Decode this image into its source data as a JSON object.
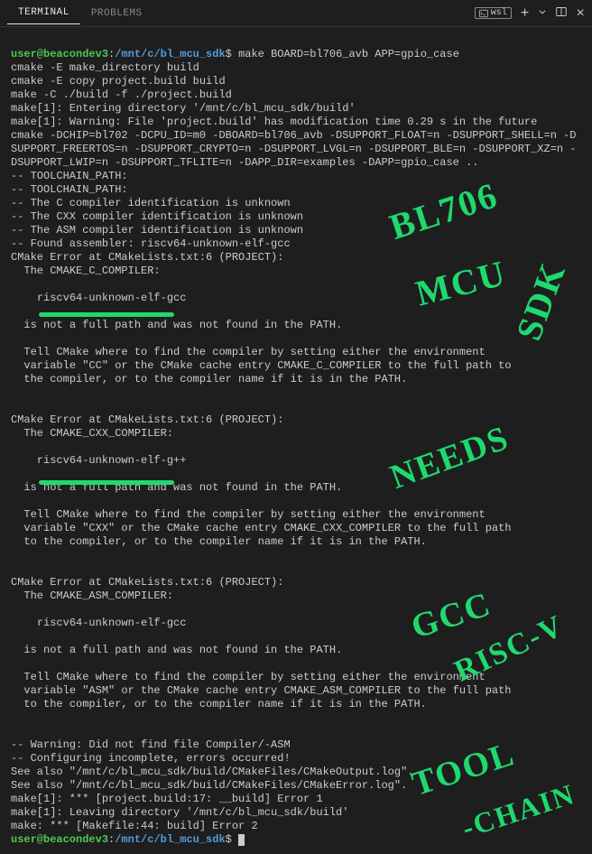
{
  "tabs": {
    "terminal": "TERMINAL",
    "problems": "PROBLEMS"
  },
  "toolbar": {
    "shell": "wsl",
    "plus": "+",
    "split": "split-icon",
    "chevron": "chevron-down-icon",
    "close": "×"
  },
  "prompt": {
    "user": "user@beacondev3",
    "sep": ":",
    "path": "/mnt/c/bl_mcu_sdk",
    "dollar": "$"
  },
  "command": "make BOARD=bl706_avb APP=gpio_case",
  "lines": [
    "cmake -E make_directory build",
    "cmake -E copy project.build build",
    "make -C ./build -f ./project.build",
    "make[1]: Entering directory '/mnt/c/bl_mcu_sdk/build'",
    "make[1]: Warning: File 'project.build' has modification time 0.29 s in the future",
    "cmake -DCHIP=bl702 -DCPU_ID=m0 -DBOARD=bl706_avb -DSUPPORT_FLOAT=n -DSUPPORT_SHELL=n -DSUPPORT_FREERTOS=n -DSUPPORT_CRYPTO=n -DSUPPORT_LVGL=n -DSUPPORT_BLE=n -DSUPPORT_XZ=n -DSUPPORT_LWIP=n -DSUPPORT_TFLITE=n -DAPP_DIR=examples -DAPP=gpio_case ..",
    "-- TOOLCHAIN_PATH:",
    "-- TOOLCHAIN_PATH:",
    "-- The C compiler identification is unknown",
    "-- The CXX compiler identification is unknown",
    "-- The ASM compiler identification is unknown",
    "-- Found assembler: riscv64-unknown-elf-gcc",
    "CMake Error at CMakeLists.txt:6 (PROJECT):",
    "  The CMAKE_C_COMPILER:",
    "",
    "    riscv64-unknown-elf-gcc",
    "",
    "  is not a full path and was not found in the PATH.",
    "",
    "  Tell CMake where to find the compiler by setting either the environment",
    "  variable \"CC\" or the CMake cache entry CMAKE_C_COMPILER to the full path to",
    "  the compiler, or to the compiler name if it is in the PATH.",
    "",
    "",
    "CMake Error at CMakeLists.txt:6 (PROJECT):",
    "  The CMAKE_CXX_COMPILER:",
    "",
    "    riscv64-unknown-elf-g++",
    "",
    "  is not a full path and was not found in the PATH.",
    "",
    "  Tell CMake where to find the compiler by setting either the environment",
    "  variable \"CXX\" or the CMake cache entry CMAKE_CXX_COMPILER to the full path",
    "  to the compiler, or to the compiler name if it is in the PATH.",
    "",
    "",
    "CMake Error at CMakeLists.txt:6 (PROJECT):",
    "  The CMAKE_ASM_COMPILER:",
    "",
    "    riscv64-unknown-elf-gcc",
    "",
    "  is not a full path and was not found in the PATH.",
    "",
    "  Tell CMake where to find the compiler by setting either the environment",
    "  variable \"ASM\" or the CMake cache entry CMAKE_ASM_COMPILER to the full path",
    "  to the compiler, or to the compiler name if it is in the PATH.",
    "",
    "",
    "-- Warning: Did not find file Compiler/-ASM",
    "-- Configuring incomplete, errors occurred!",
    "See also \"/mnt/c/bl_mcu_sdk/build/CMakeFiles/CMakeOutput.log\".",
    "See also \"/mnt/c/bl_mcu_sdk/build/CMakeFiles/CMakeError.log\".",
    "make[1]: *** [project.build:17: __build] Error 1",
    "make[1]: Leaving directory '/mnt/c/bl_mcu_sdk/build'",
    "make: *** [Makefile:44: build] Error 2"
  ],
  "annotations": {
    "a1": "BL706",
    "a2": "MCU",
    "a3": "SDK",
    "a4": "NEEDS",
    "a5": "GCC",
    "a6": "RISC-V",
    "a7": "TOOL",
    "a8": "-CHAIN"
  }
}
